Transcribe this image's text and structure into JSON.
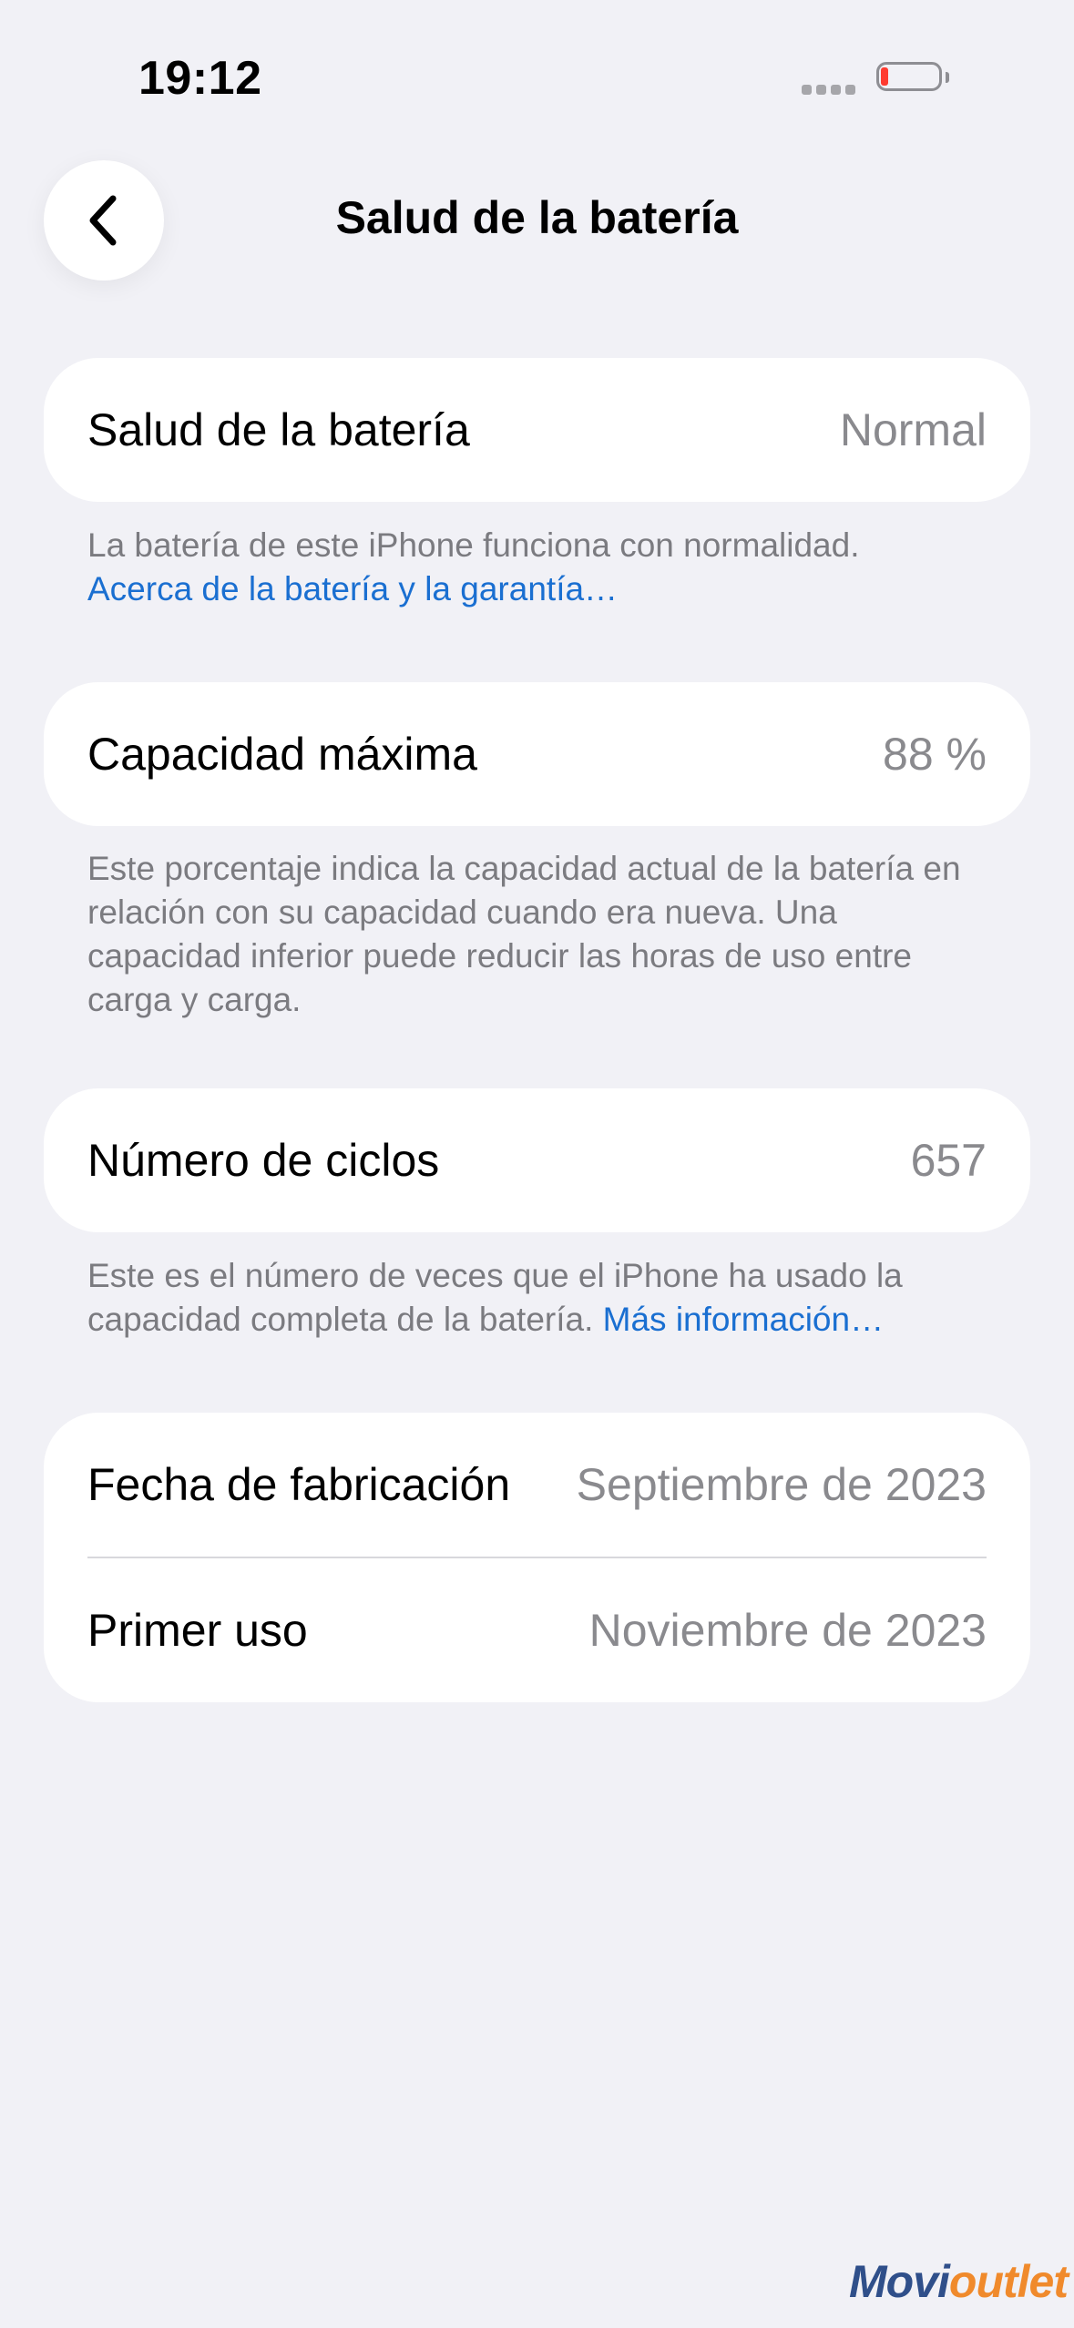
{
  "status": {
    "time": "19:12"
  },
  "nav": {
    "title": "Salud de la batería"
  },
  "health": {
    "label": "Salud de la batería",
    "value": "Normal",
    "note": "La batería de este iPhone funciona con normalidad.",
    "link": "Acerca de la batería y la garantía…"
  },
  "capacity": {
    "label": "Capacidad máxima",
    "value": "88 %",
    "note": "Este porcentaje indica la capacidad actual de la batería en relación con su capacidad cuando era nueva. Una capacidad inferior puede reducir las horas de uso entre carga y carga."
  },
  "cycles": {
    "label": "Número de ciclos",
    "value": "657",
    "note": "Este es el número de veces que el iPhone ha usado la capacidad completa de la batería.",
    "link": "Más información…"
  },
  "dates": {
    "manufacture_label": "Fecha de fabricación",
    "manufacture_value": "Septiembre de 2023",
    "first_use_label": "Primer uso",
    "first_use_value": "Noviembre de 2023"
  },
  "watermark": {
    "part1": "Movi",
    "part2": "outlet"
  },
  "icons": {
    "back": "chevron-left-icon",
    "battery": "battery-low-icon",
    "signal": "signal-dots-icon"
  },
  "colors": {
    "link": "#1a6fd1",
    "battery_low": "#ff3b30",
    "background": "#f1f1f6"
  }
}
